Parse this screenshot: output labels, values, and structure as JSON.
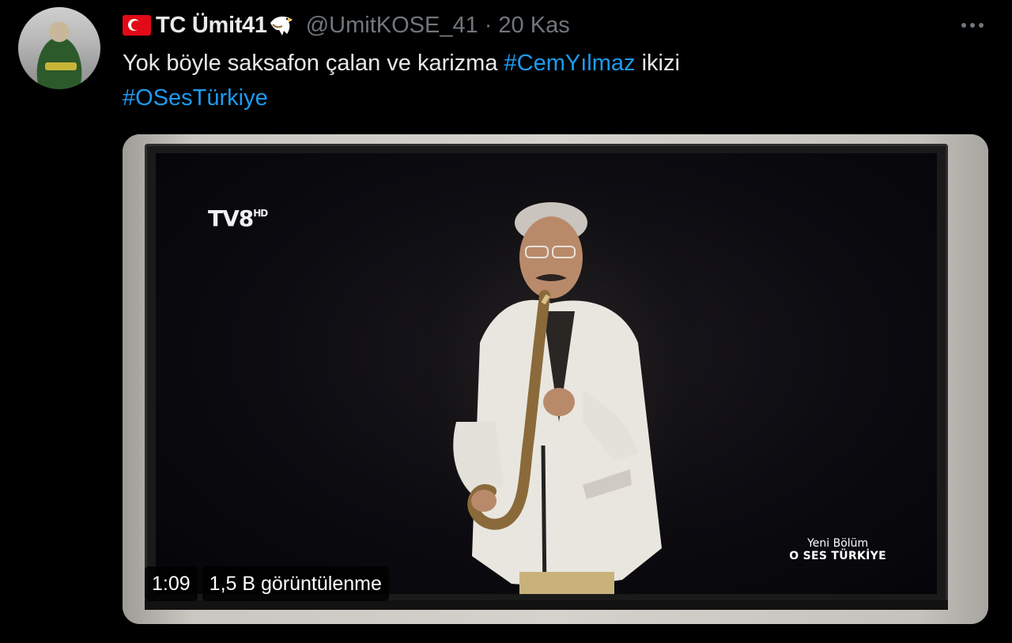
{
  "tweet": {
    "display_name": "TC Ümit41",
    "handle": "@UmitKOSE_41",
    "separator": "·",
    "date": "20 Kas",
    "text_part1": "Yok böyle saksafon çalan ve karizma ",
    "hashtag1": "#CemYılmaz",
    "text_part2": " ikizi",
    "hashtag2": "#OSesTürkiye"
  },
  "media": {
    "channel_logo": "TV8",
    "caption_line1": "Yeni Bölüm",
    "caption_line2": "O SES TÜRKİYE",
    "duration": "1:09",
    "views": "1,5 B görüntülenme"
  },
  "colors": {
    "background": "#000000",
    "text_primary": "#e7e9ea",
    "text_secondary": "#71767b",
    "link": "#1d9bf0"
  },
  "icons": [
    "turkish-flag-icon",
    "eagle-icon",
    "more-options-icon"
  ]
}
